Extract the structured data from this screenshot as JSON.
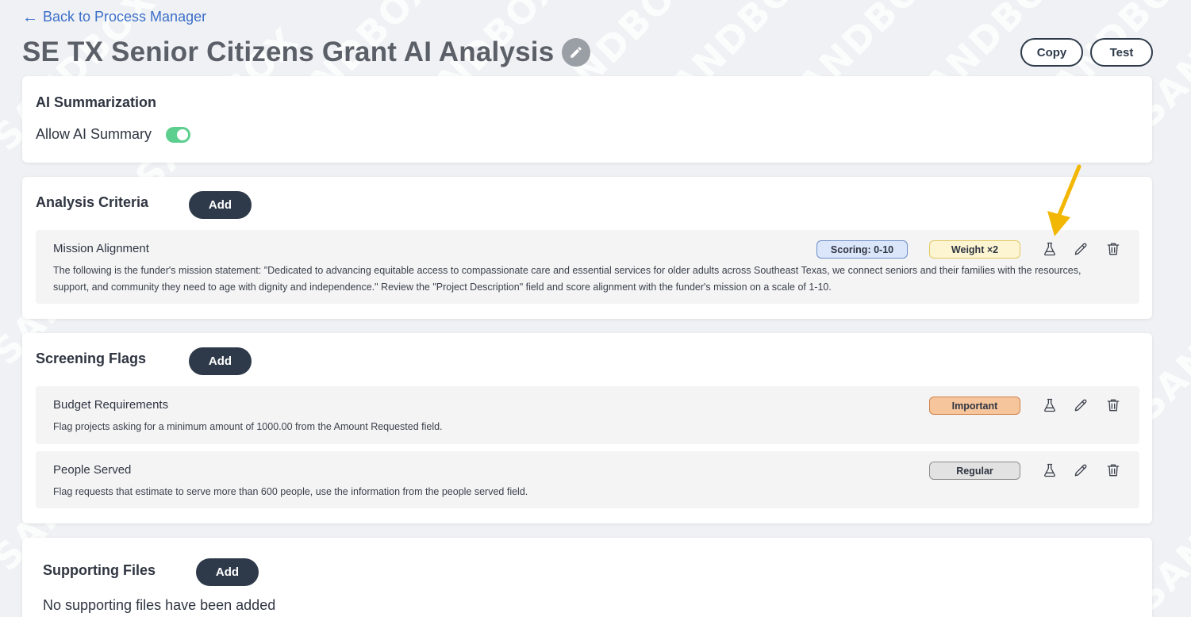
{
  "nav": {
    "back_label": "Back to Process Manager"
  },
  "header": {
    "title": "SE TX Senior Citizens Grant AI Analysis",
    "copy_label": "Copy",
    "test_label": "Test"
  },
  "watermark": "SANDBOX",
  "ai_summarization": {
    "title": "AI Summarization",
    "toggle_label": "Allow AI Summary",
    "toggle_on": true,
    "toggle_color": "#5ccf8f"
  },
  "analysis_criteria": {
    "title": "Analysis Criteria",
    "add_label": "Add",
    "items": [
      {
        "name": "Mission Alignment",
        "description": "The following is the funder's mission statement: \"Dedicated to advancing equitable access to compassionate care and essential services for older adults across Southeast Texas, we connect seniors and their families with the resources, support, and community they need to age with dignity and independence.\" Review the \"Project Description\" field and score alignment with the funder's mission on a scale of 1-10.",
        "scoring_badge": "Scoring: 0-10",
        "weight_badge": "Weight ×2"
      }
    ]
  },
  "screening_flags": {
    "title": "Screening Flags",
    "add_label": "Add",
    "items": [
      {
        "name": "Budget Requirements",
        "description": "Flag projects asking for a minimum amount of 1000.00 from the Amount Requested field.",
        "priority_badge": "Important"
      },
      {
        "name": "People Served",
        "description": "Flag requests that estimate to serve more than 600 people, use the information from the people served field.",
        "priority_badge": "Regular"
      }
    ]
  },
  "supporting_files": {
    "title": "Supporting Files",
    "add_label": "Add",
    "empty_text": "No supporting files have been added"
  },
  "colors": {
    "primary_dark": "#2e3a4a",
    "link": "#3b6fc9",
    "annotation_arrow": "#f2b705"
  }
}
